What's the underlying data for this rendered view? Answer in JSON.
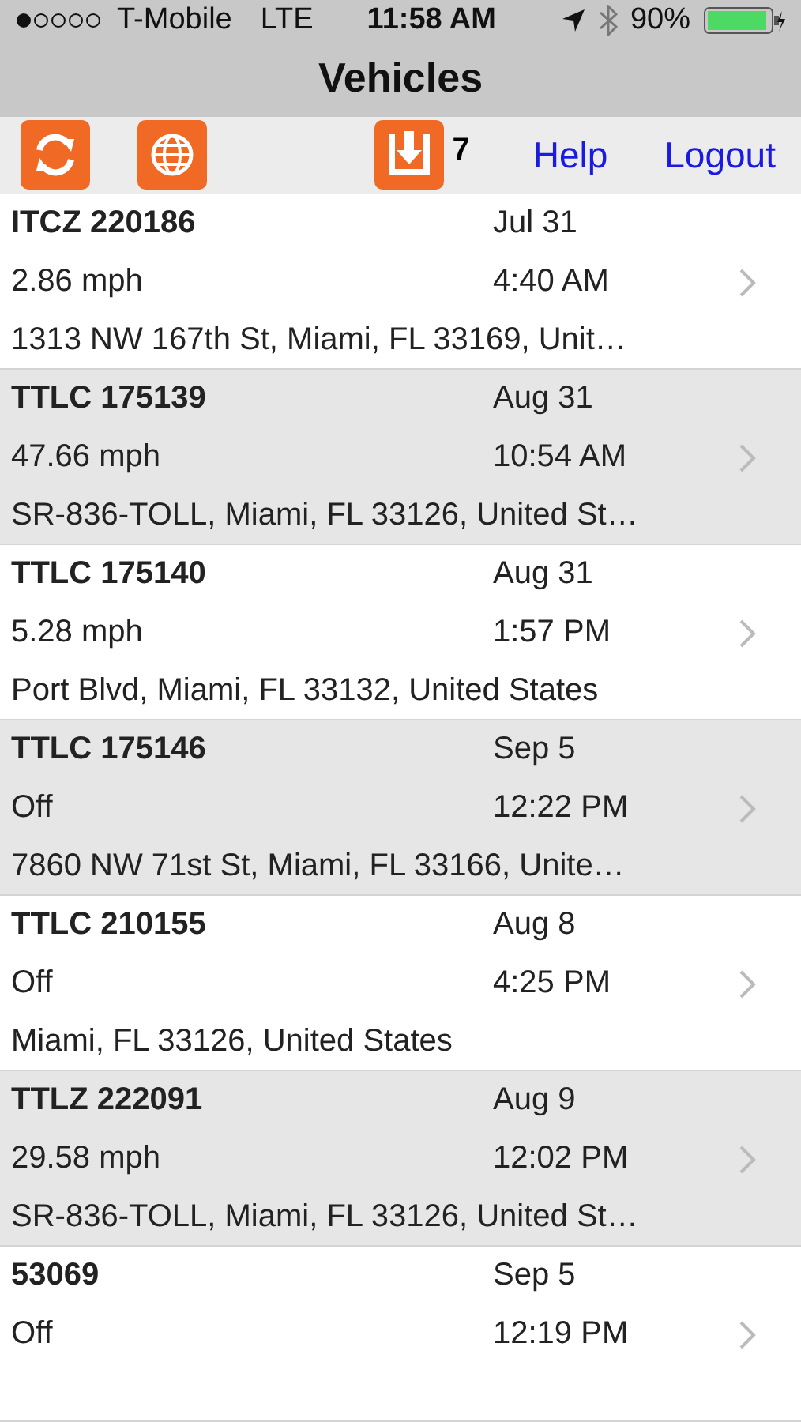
{
  "status_bar": {
    "carrier": "T-Mobile",
    "network": "LTE",
    "time": "11:58 AM",
    "battery": "90%"
  },
  "nav": {
    "title": "Vehicles"
  },
  "toolbar": {
    "badge": "7",
    "links": [
      "Help",
      "Logout"
    ]
  },
  "vehicles": [
    {
      "name": "ITCZ 220186",
      "date": "Jul 31",
      "speed": "2.86 mph",
      "time": "4:40 AM",
      "address": "1313 NW 167th St, Miami, FL 33169, Unit…"
    },
    {
      "name": "TTLC 175139",
      "date": "Aug 31",
      "speed": "47.66 mph",
      "time": "10:54 AM",
      "address": "SR-836-TOLL, Miami, FL 33126, United St…"
    },
    {
      "name": "TTLC 175140",
      "date": "Aug 31",
      "speed": "5.28 mph",
      "time": "1:57 PM",
      "address": "Port Blvd, Miami, FL 33132, United States"
    },
    {
      "name": "TTLC 175146",
      "date": "Sep 5",
      "speed": "Off",
      "time": "12:22 PM",
      "address": "7860 NW 71st St, Miami, FL 33166, Unite…"
    },
    {
      "name": "TTLC 210155",
      "date": "Aug 8",
      "speed": "Off",
      "time": "4:25 PM",
      "address": "Miami, FL 33126, United States"
    },
    {
      "name": "TTLZ 222091",
      "date": "Aug 9",
      "speed": "29.58 mph",
      "time": "12:02 PM",
      "address": "SR-836-TOLL, Miami, FL 33126, United St…"
    },
    {
      "name": "53069",
      "date": "Sep 5",
      "speed": "Off",
      "time": "12:19 PM"
    }
  ]
}
